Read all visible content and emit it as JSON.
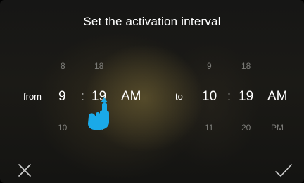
{
  "title": "Set the activation interval",
  "from": {
    "label": "from",
    "hour_prev": "8",
    "hour": "9",
    "hour_next": "10",
    "separator": ":",
    "minute_prev": "18",
    "minute": "19",
    "minute_next": "20",
    "ampm": "AM"
  },
  "to": {
    "label": "to",
    "hour_prev": "9",
    "hour": "10",
    "hour_next": "11",
    "separator": ":",
    "minute_prev": "18",
    "minute": "19",
    "minute_next": "20",
    "ampm": "AM",
    "ampm_next": "PM"
  },
  "icons": {
    "cancel": "close-icon",
    "confirm": "check-icon",
    "pointer": "hand-pointer-icon"
  },
  "colors": {
    "accent": "#1aa9e8",
    "text": "#ffffff",
    "dim_text": "#7c7c78"
  }
}
